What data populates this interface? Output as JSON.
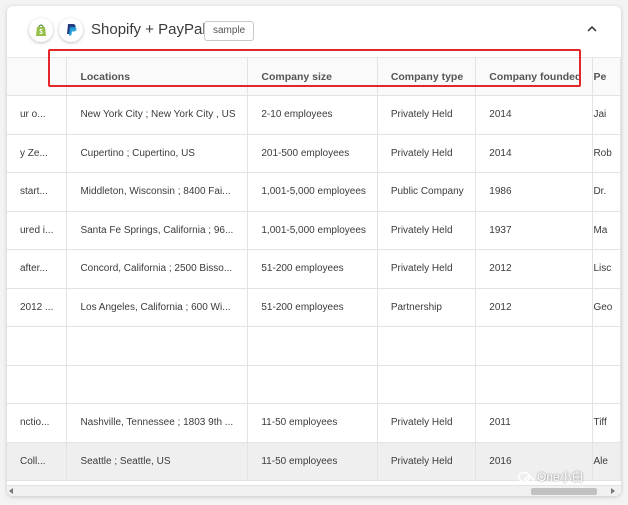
{
  "header": {
    "title": "Shopify + PayPal",
    "badge": "sample",
    "icons": [
      "shopify-icon",
      "paypal-icon",
      "chevron-up-icon"
    ]
  },
  "table": {
    "columns": [
      "Locations",
      "Company size",
      "Company type",
      "Company founded",
      "Pe"
    ],
    "rows": [
      {
        "partial": "ur o...",
        "location": "New York City ; New York City , US",
        "size": "2-10 employees",
        "type": "Privately Held",
        "founded": "2014",
        "next": "Jai"
      },
      {
        "partial": "y Ze...",
        "location": "Cupertino ; Cupertino, US",
        "size": "201-500 employees",
        "type": "Privately Held",
        "founded": "2014",
        "next": "Rob"
      },
      {
        "partial": "start...",
        "location": "Middleton, Wisconsin ; 8400 Fai...",
        "size": "1,001-5,000 employees",
        "type": "Public Company",
        "founded": "1986",
        "next": "Dr."
      },
      {
        "partial": "ured i...",
        "location": "Santa Fe Springs, California ; 96...",
        "size": "1,001-5,000 employees",
        "type": "Privately Held",
        "founded": "1937",
        "next": "Ma"
      },
      {
        "partial": "after...",
        "location": "Concord, California ; 2500 Bisso...",
        "size": "51-200 employees",
        "type": "Privately Held",
        "founded": "2012",
        "next": "Lisc"
      },
      {
        "partial": "2012 ...",
        "location": "Los Angeles, California ; 600 Wi...",
        "size": "51-200 employees",
        "type": "Partnership",
        "founded": "2012",
        "next": "Geo"
      },
      {
        "partial": "",
        "location": "",
        "size": "",
        "type": "",
        "founded": "",
        "next": ""
      },
      {
        "partial": "",
        "location": "",
        "size": "",
        "type": "",
        "founded": "",
        "next": ""
      },
      {
        "partial": "nctio...",
        "location": "Nashville, Tennessee ; 1803 9th ...",
        "size": "11-50 employees",
        "type": "Privately Held",
        "founded": "2011",
        "next": "Tiff"
      },
      {
        "partial": "Coll...",
        "location": "Seattle ; Seattle, US",
        "size": "11-50 employees",
        "type": "Privately Held",
        "founded": "2016",
        "next": "Ale"
      }
    ],
    "selected_row": 9
  },
  "watermark": "One小白",
  "colors": {
    "highlight": "#e3262a",
    "shopify": "#95bf47",
    "paypal_dark": "#253b80",
    "paypal_light": "#179bd7"
  }
}
